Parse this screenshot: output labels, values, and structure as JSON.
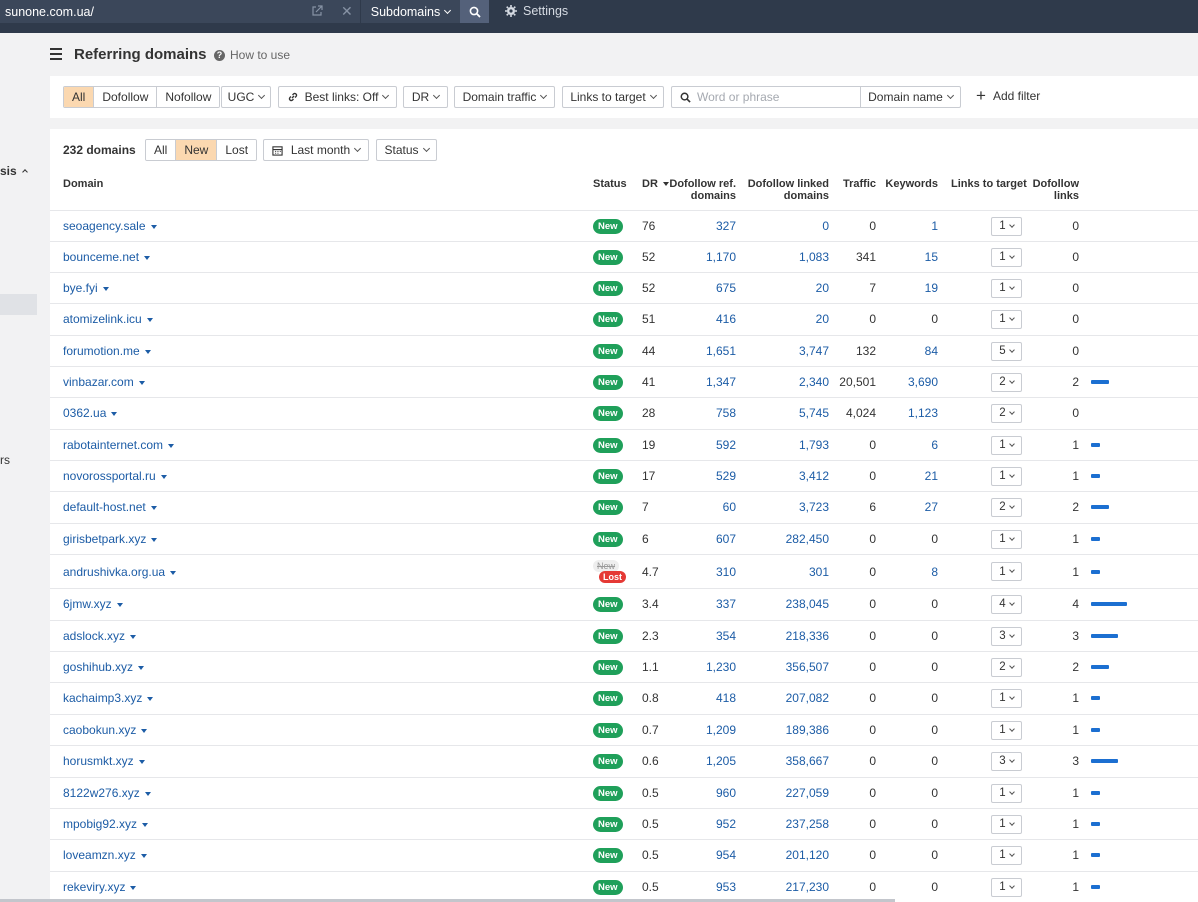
{
  "topbar": {
    "url": "sunone.com.ua/",
    "mode": "Subdomains",
    "settings_label": "Settings",
    "icons": [
      "external-link-icon",
      "close-icon",
      "search-icon",
      "gear-icon"
    ]
  },
  "sidebar": {
    "fragment_1": "sis",
    "fragment_2": "rs"
  },
  "header": {
    "title": "Referring domains",
    "how_to_use": "How to use"
  },
  "filters": {
    "link_types": [
      {
        "label": "All",
        "active": true
      },
      {
        "label": "Dofollow",
        "active": false
      },
      {
        "label": "Nofollow",
        "active": false
      }
    ],
    "ugc": "UGC",
    "best_links": "Best links: Off",
    "dr": "DR",
    "domain_traffic": "Domain traffic",
    "links_to_target": "Links to target",
    "search_placeholder": "Word or phrase",
    "search_value": "",
    "domain_name": "Domain name",
    "add_filter": "Add filter"
  },
  "table_controls": {
    "count": "232 domains",
    "status_tabs": [
      {
        "label": "All",
        "active": false
      },
      {
        "label": "New",
        "active": true
      },
      {
        "label": "Lost",
        "active": false
      }
    ],
    "period": "Last month",
    "status": "Status"
  },
  "columns": {
    "domain": "Domain",
    "status": "Status",
    "dr": "DR",
    "dofollow_ref_domains_1": "Dofollow ref.",
    "dofollow_ref_domains_2": "domains",
    "dofollow_linked_domains_1": "Dofollow linked",
    "dofollow_linked_domains_2": "domains",
    "traffic": "Traffic",
    "keywords": "Keywords",
    "links_to_target": "Links to target",
    "dofollow_links_1": "Dofollow",
    "dofollow_links_2": "links"
  },
  "status_labels": {
    "new": "New",
    "lost": "Lost"
  },
  "rows": [
    {
      "domain": "seoagency.sale",
      "status": "New",
      "dr": "76",
      "ref": "327",
      "linked": "0",
      "traffic": "0",
      "keywords": "1",
      "ltt": "1",
      "dofollow": "0",
      "bar": 0
    },
    {
      "domain": "bounceme.net",
      "status": "New",
      "dr": "52",
      "ref": "1,170",
      "linked": "1,083",
      "traffic": "341",
      "keywords": "15",
      "ltt": "1",
      "dofollow": "0",
      "bar": 0
    },
    {
      "domain": "bye.fyi",
      "status": "New",
      "dr": "52",
      "ref": "675",
      "linked": "20",
      "traffic": "7",
      "keywords": "19",
      "ltt": "1",
      "dofollow": "0",
      "bar": 0
    },
    {
      "domain": "atomizelink.icu",
      "status": "New",
      "dr": "51",
      "ref": "416",
      "linked": "20",
      "traffic": "0",
      "keywords": "0",
      "ltt": "1",
      "dofollow": "0",
      "bar": 0
    },
    {
      "domain": "forumotion.me",
      "status": "New",
      "dr": "44",
      "ref": "1,651",
      "linked": "3,747",
      "traffic": "132",
      "keywords": "84",
      "ltt": "5",
      "dofollow": "0",
      "bar": 0
    },
    {
      "domain": "vinbazar.com",
      "status": "New",
      "dr": "41",
      "ref": "1,347",
      "linked": "2,340",
      "traffic": "20,501",
      "keywords": "3,690",
      "ltt": "2",
      "dofollow": "2",
      "bar": 2
    },
    {
      "domain": "0362.ua",
      "status": "New",
      "dr": "28",
      "ref": "758",
      "linked": "5,745",
      "traffic": "4,024",
      "keywords": "1,123",
      "ltt": "2",
      "dofollow": "0",
      "bar": 0
    },
    {
      "domain": "rabotainternet.com",
      "status": "New",
      "dr": "19",
      "ref": "592",
      "linked": "1,793",
      "traffic": "0",
      "keywords": "6",
      "ltt": "1",
      "dofollow": "1",
      "bar": 1
    },
    {
      "domain": "novorossportal.ru",
      "status": "New",
      "dr": "17",
      "ref": "529",
      "linked": "3,412",
      "traffic": "0",
      "keywords": "21",
      "ltt": "1",
      "dofollow": "1",
      "bar": 1
    },
    {
      "domain": "default-host.net",
      "status": "New",
      "dr": "7",
      "ref": "60",
      "linked": "3,723",
      "traffic": "6",
      "keywords": "27",
      "ltt": "2",
      "dofollow": "2",
      "bar": 2
    },
    {
      "domain": "girisbetpark.xyz",
      "status": "New",
      "dr": "6",
      "ref": "607",
      "linked": "282,450",
      "traffic": "0",
      "keywords": "0",
      "ltt": "1",
      "dofollow": "1",
      "bar": 1
    },
    {
      "domain": "andrushivka.org.ua",
      "status": "NewLost",
      "dr": "4.7",
      "ref": "310",
      "linked": "301",
      "traffic": "0",
      "keywords": "8",
      "ltt": "1",
      "dofollow": "1",
      "bar": 1
    },
    {
      "domain": "6jmw.xyz",
      "status": "New",
      "dr": "3.4",
      "ref": "337",
      "linked": "238,045",
      "traffic": "0",
      "keywords": "0",
      "ltt": "4",
      "dofollow": "4",
      "bar": 4
    },
    {
      "domain": "adslock.xyz",
      "status": "New",
      "dr": "2.3",
      "ref": "354",
      "linked": "218,336",
      "traffic": "0",
      "keywords": "0",
      "ltt": "3",
      "dofollow": "3",
      "bar": 3
    },
    {
      "domain": "goshihub.xyz",
      "status": "New",
      "dr": "1.1",
      "ref": "1,230",
      "linked": "356,507",
      "traffic": "0",
      "keywords": "0",
      "ltt": "2",
      "dofollow": "2",
      "bar": 2
    },
    {
      "domain": "kachaimp3.xyz",
      "status": "New",
      "dr": "0.8",
      "ref": "418",
      "linked": "207,082",
      "traffic": "0",
      "keywords": "0",
      "ltt": "1",
      "dofollow": "1",
      "bar": 1
    },
    {
      "domain": "caobokun.xyz",
      "status": "New",
      "dr": "0.7",
      "ref": "1,209",
      "linked": "189,386",
      "traffic": "0",
      "keywords": "0",
      "ltt": "1",
      "dofollow": "1",
      "bar": 1
    },
    {
      "domain": "horusmkt.xyz",
      "status": "New",
      "dr": "0.6",
      "ref": "1,205",
      "linked": "358,667",
      "traffic": "0",
      "keywords": "0",
      "ltt": "3",
      "dofollow": "3",
      "bar": 3
    },
    {
      "domain": "8122w276.xyz",
      "status": "New",
      "dr": "0.5",
      "ref": "960",
      "linked": "227,059",
      "traffic": "0",
      "keywords": "0",
      "ltt": "1",
      "dofollow": "1",
      "bar": 1
    },
    {
      "domain": "mpobig92.xyz",
      "status": "New",
      "dr": "0.5",
      "ref": "952",
      "linked": "237,258",
      "traffic": "0",
      "keywords": "0",
      "ltt": "1",
      "dofollow": "1",
      "bar": 1
    },
    {
      "domain": "loveamzn.xyz",
      "status": "New",
      "dr": "0.5",
      "ref": "954",
      "linked": "201,120",
      "traffic": "0",
      "keywords": "0",
      "ltt": "1",
      "dofollow": "1",
      "bar": 1
    },
    {
      "domain": "rekeviry.xyz",
      "status": "New",
      "dr": "0.5",
      "ref": "953",
      "linked": "217,230",
      "traffic": "0",
      "keywords": "0",
      "ltt": "1",
      "dofollow": "1",
      "bar": 1
    }
  ],
  "colors": {
    "accent": "#fbd8b0",
    "link": "#1c5ca6",
    "new_badge": "#1fa05a",
    "lost_badge": "#e53935",
    "bar": "#1c6fd1",
    "topbar": "#2f3a4b"
  }
}
